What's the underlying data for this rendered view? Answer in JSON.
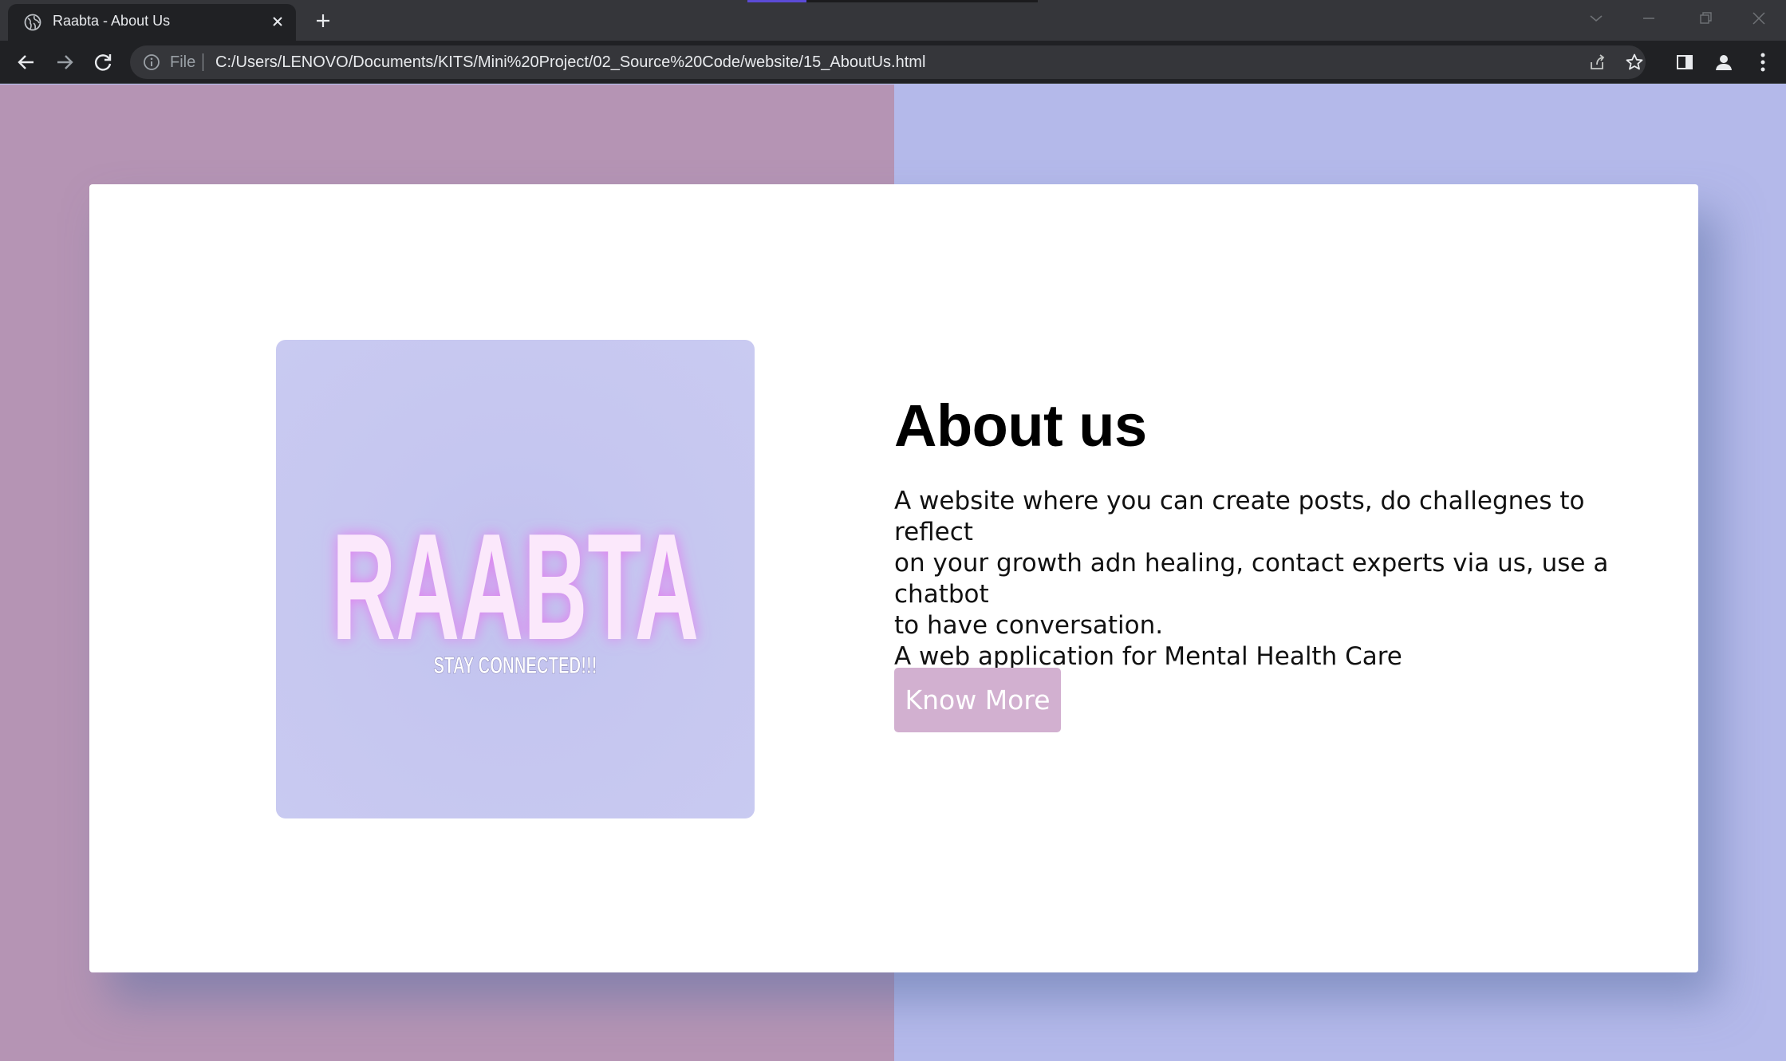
{
  "browser": {
    "tab_title": "Raabta - About Us",
    "file_label": "File",
    "url": "C:/Users/LENOVO/Documents/KITS/Mini%20Project/02_Source%20Code/website/15_AboutUs.html",
    "icons": [
      "globe-icon",
      "close-icon",
      "plus-icon",
      "chevron-down-icon",
      "minimize-icon",
      "restore-icon",
      "close-window-icon",
      "back-icon",
      "forward-icon",
      "reload-icon",
      "info-icon",
      "share-icon",
      "star-icon",
      "side-panel-icon",
      "profile-icon",
      "more-icon"
    ]
  },
  "page": {
    "colors": {
      "left_bg": "#b594b4",
      "right_bg": "#b4b9ea",
      "card": "#ffffff",
      "logo_bg": "#c5c6f0",
      "button": "#d2b0d0"
    },
    "logo": {
      "wordmark": "RAABTA",
      "tagline": "STAY CONNECTED!!!"
    },
    "about": {
      "title": "About us",
      "lines": [
        "A website where you can create posts, do challegnes to reflect",
        "on your growth adn healing, contact experts via us, use a chatbot",
        "to have conversation.",
        "A web application for Mental Health Care"
      ],
      "button_label": "Know More"
    }
  }
}
